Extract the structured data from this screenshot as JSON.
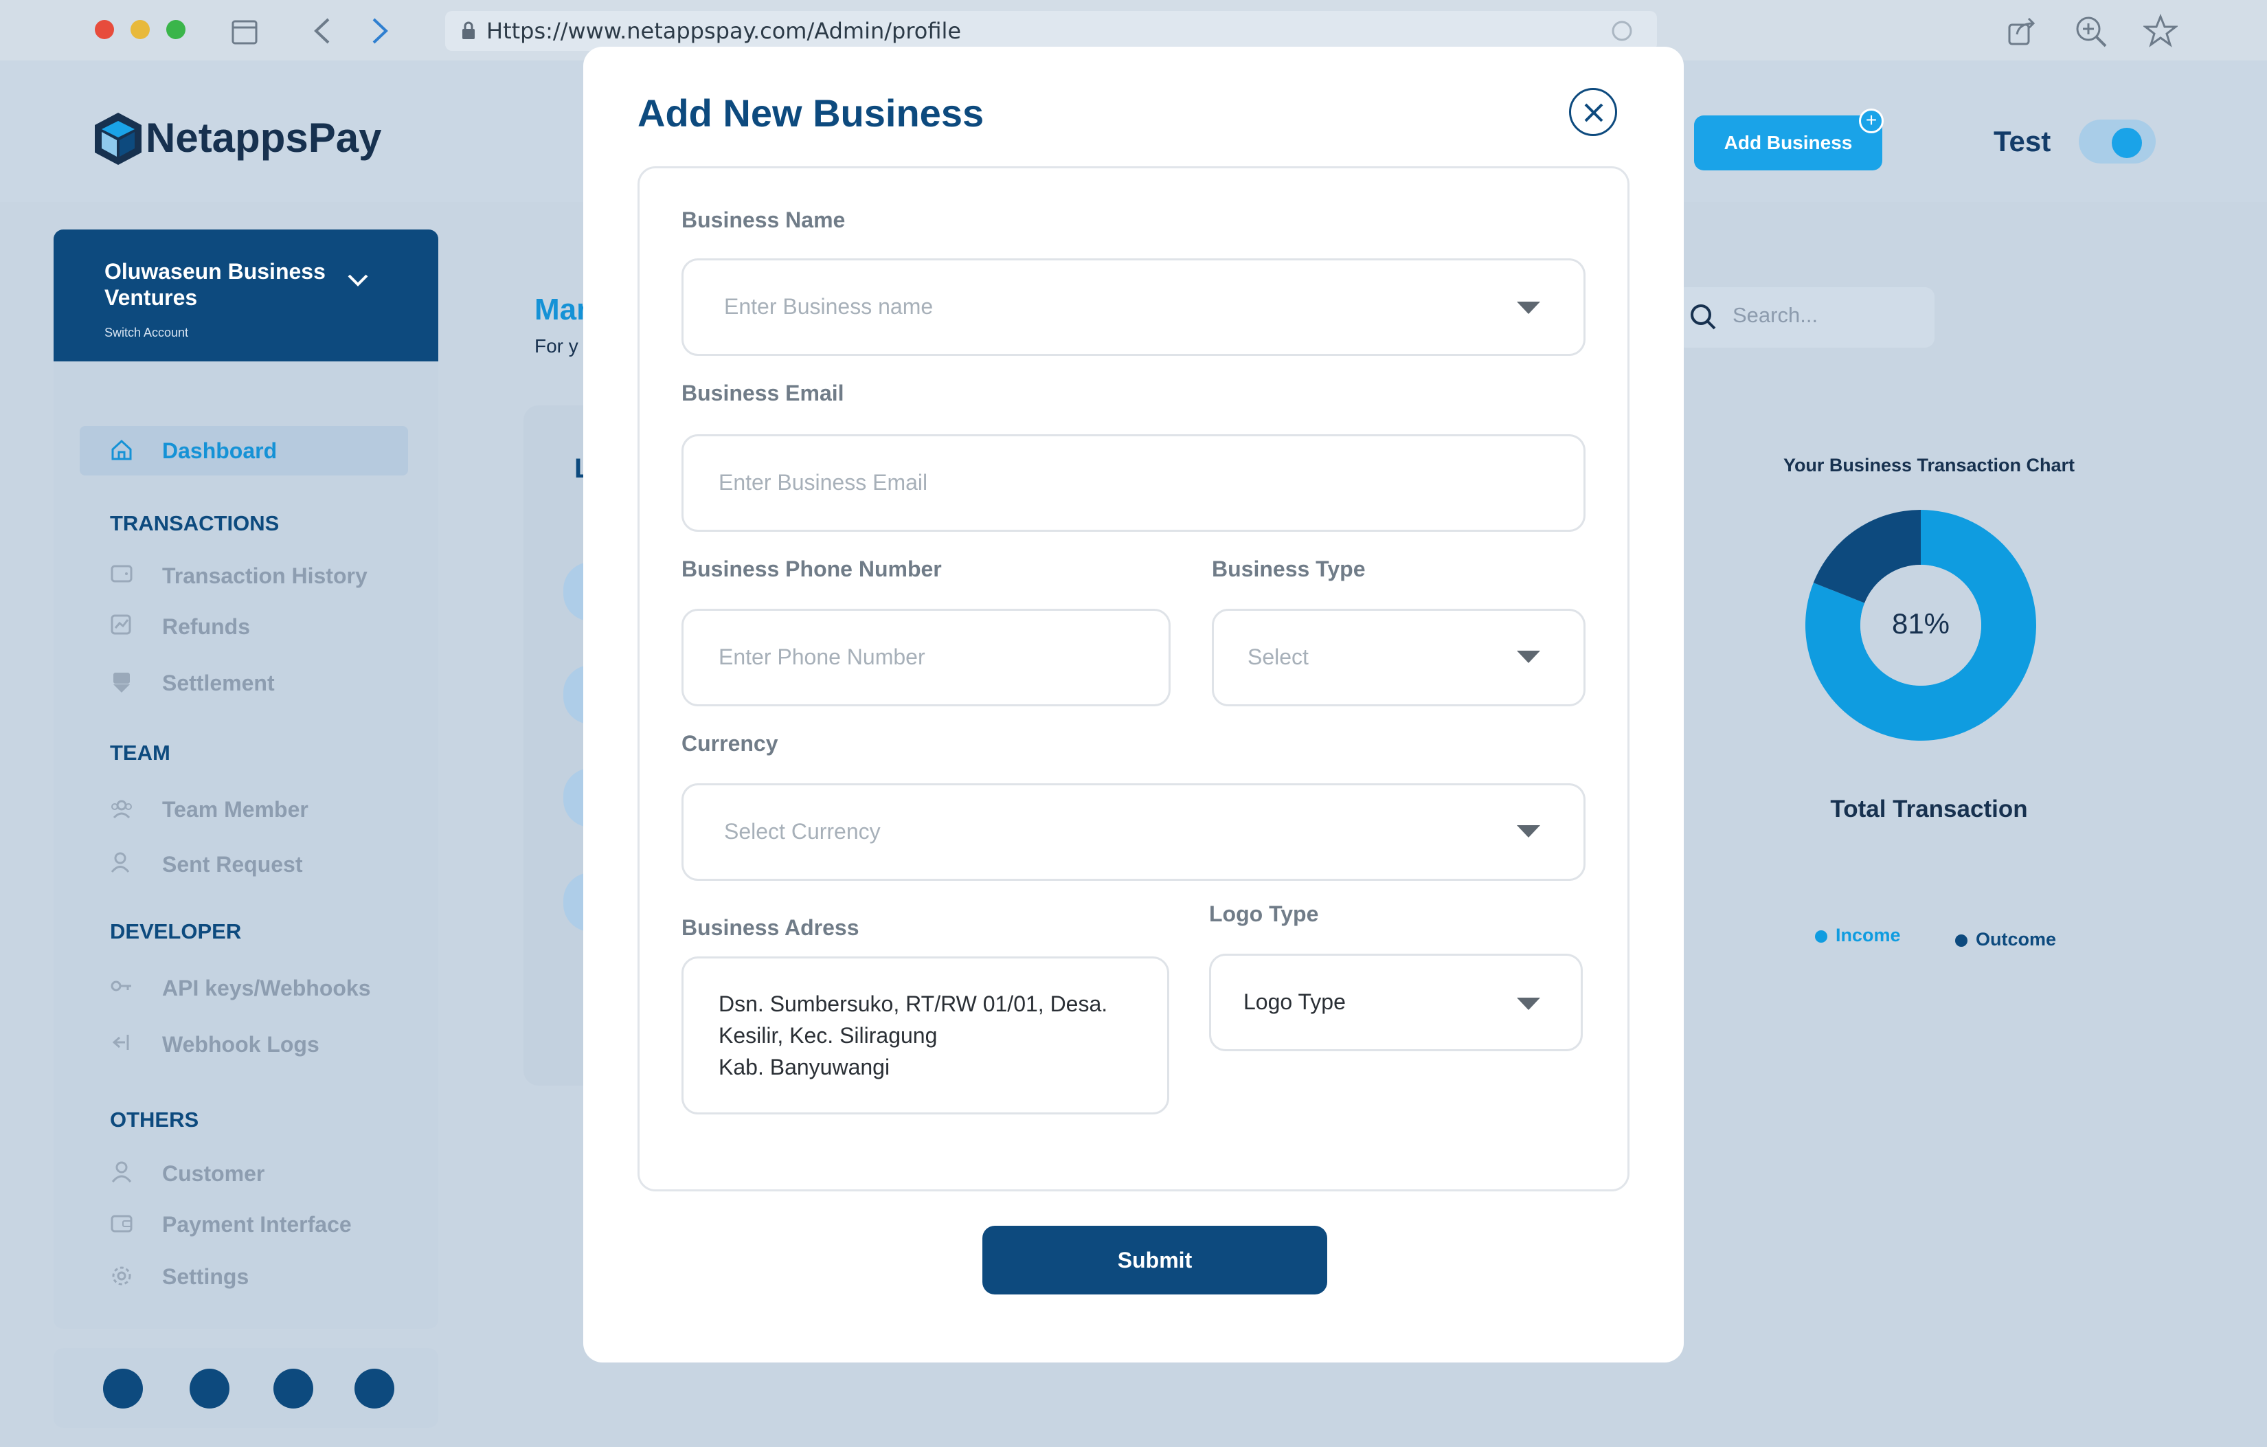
{
  "browser": {
    "url": "Https://www.netappspay.com/Admin/profile"
  },
  "header": {
    "brand": "NetappsPay",
    "add_business_label": "Add Business",
    "mode_label": "Test"
  },
  "account": {
    "name": "Oluwaseun Business Ventures",
    "switch_label": "Switch Account"
  },
  "sidebar": {
    "dashboard": "Dashboard",
    "sections": [
      {
        "title": "TRANSACTIONS",
        "items": [
          "Transaction History",
          "Refunds",
          "Settlement"
        ]
      },
      {
        "title": "TEAM",
        "items": [
          "Team Member",
          "Sent Request"
        ]
      },
      {
        "title": "DEVELOPER",
        "items": [
          "API keys/Webhooks",
          "Webhook Logs"
        ]
      },
      {
        "title": "OTHERS",
        "items": [
          "Customer",
          "Payment Interface",
          "Settings"
        ]
      }
    ]
  },
  "page": {
    "title_partial": "Mar",
    "subtitle_partial": "For y",
    "card_heading_partial": "L",
    "search_placeholder": "Search..."
  },
  "chart": {
    "title": "Your Business Transaction Chart",
    "center_label": "81%",
    "caption": "Total Transaction",
    "legend": [
      "Income",
      "Outcome"
    ]
  },
  "chart_data": {
    "type": "pie",
    "title": "Your Business Transaction Chart",
    "series": [
      {
        "name": "Income",
        "value": 81,
        "color": "#0f9ce0"
      },
      {
        "name": "Outcome",
        "value": 19,
        "color": "#0d4a7e"
      }
    ]
  },
  "modal": {
    "title": "Add New Business",
    "fields": {
      "business_name": {
        "label": "Business Name",
        "placeholder": "Enter Business name"
      },
      "business_email": {
        "label": "Business Email",
        "placeholder": "Enter Business Email"
      },
      "business_phone": {
        "label": "Business Phone Number",
        "placeholder": "Enter Phone Number"
      },
      "business_type": {
        "label": "Business Type",
        "placeholder": "Select"
      },
      "currency": {
        "label": "Currency",
        "placeholder": "Select Currency"
      },
      "business_address": {
        "label": "Business Adress",
        "value_lines": [
          "Dsn. Sumbersuko, RT/RW 01/01, Desa.",
          "Kesilir, Kec. Siliragung",
          "Kab. Banyuwangi"
        ]
      },
      "logo_type": {
        "label": "Logo Type",
        "value": "Logo Type"
      }
    },
    "submit_label": "Submit"
  },
  "colors": {
    "primary": "#0d4a7e",
    "accent": "#1aa3e8"
  }
}
